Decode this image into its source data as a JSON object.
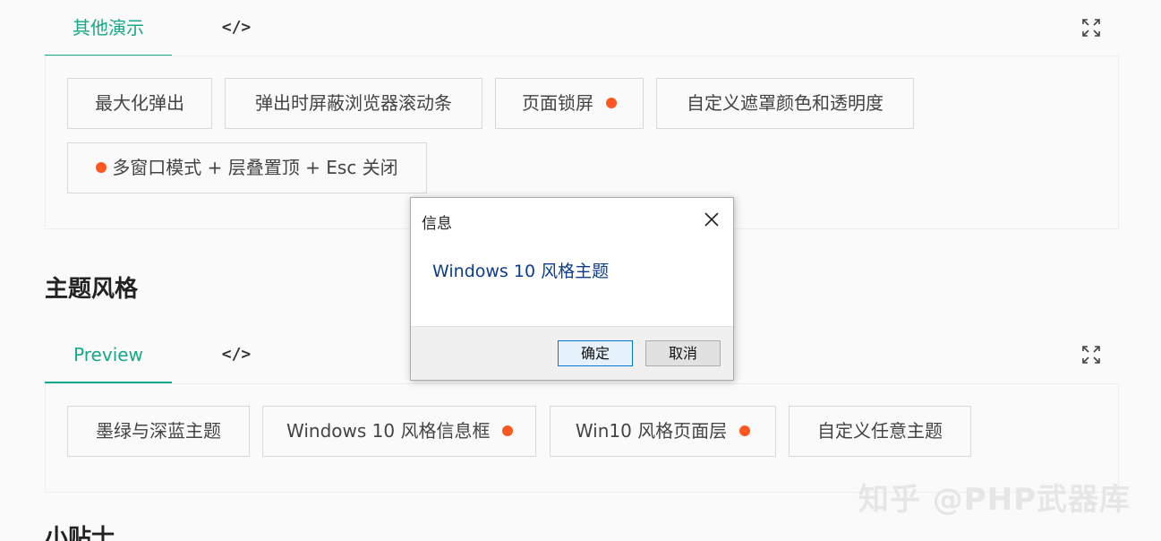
{
  "section1": {
    "tabs": [
      {
        "label": "其他演示",
        "active": true
      },
      {
        "label": "</>",
        "active": false
      }
    ],
    "buttons": [
      {
        "label": "最大化弹出",
        "dot": false
      },
      {
        "label": "弹出时屏蔽浏览器滚动条",
        "dot": false
      },
      {
        "label": "页面锁屏",
        "dot": true
      },
      {
        "label": "自定义遮罩颜色和透明度",
        "dot": false
      },
      {
        "label": "多窗口模式 + 层叠置顶 + Esc 关闭",
        "dot": true
      }
    ]
  },
  "theme_section": {
    "title": "主题风格",
    "tabs": [
      {
        "label": "Preview",
        "active": true
      },
      {
        "label": "</>",
        "active": false
      }
    ],
    "buttons": [
      {
        "label": "墨绿与深蓝主题",
        "dot": false
      },
      {
        "label": "Windows 10 风格信息框",
        "dot": true
      },
      {
        "label": "Win10 风格页面层",
        "dot": true
      },
      {
        "label": "自定义任意主题",
        "dot": false
      }
    ]
  },
  "tips_section": {
    "title": "小贴士"
  },
  "dialog": {
    "title": "信息",
    "message": "Windows 10 风格主题",
    "ok_label": "确定",
    "cancel_label": "取消"
  },
  "watermark": "知乎 @PHP武器库",
  "colors": {
    "accent": "#16a888",
    "dot": "#ff5722",
    "dialog_text": "#0c3d8c"
  }
}
